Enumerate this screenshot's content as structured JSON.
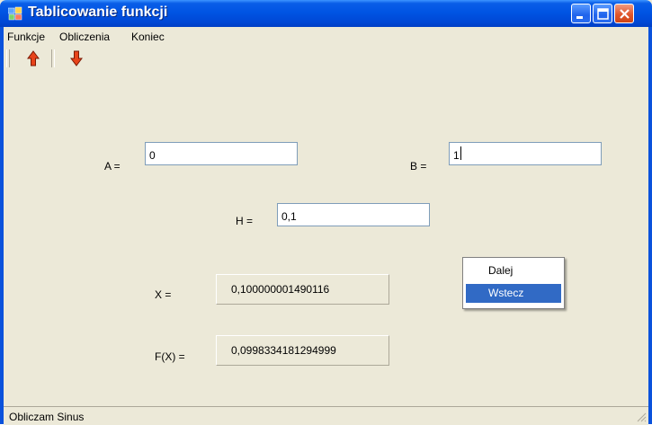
{
  "window": {
    "title": "Tablicowanie funkcji",
    "controls": [
      "minimize-icon",
      "maximize-icon",
      "close-icon"
    ]
  },
  "menu": {
    "items": [
      "Funkcje",
      "Obliczenia",
      "Koniec"
    ]
  },
  "toolbar": {
    "buttons": [
      {
        "icon": "arrow-up-icon",
        "color": "#e8431a"
      },
      {
        "icon": "arrow-down-icon",
        "color": "#e8431a"
      }
    ]
  },
  "inputs": {
    "a": {
      "label": "A =",
      "value": "0"
    },
    "b": {
      "label": "B =",
      "value": "1"
    },
    "h": {
      "label": "H =",
      "value": "0,1"
    }
  },
  "results": {
    "x": {
      "label": "X =",
      "value": "0,100000001490116"
    },
    "fx": {
      "label": "F(X) =",
      "value": "0,0998334181294999"
    }
  },
  "context_menu": {
    "items": [
      "Dalej",
      "Wstecz"
    ],
    "highlighted": "Wstecz",
    "highlight_color": "#316ac5"
  },
  "status": {
    "text": "Obliczam Sinus"
  }
}
